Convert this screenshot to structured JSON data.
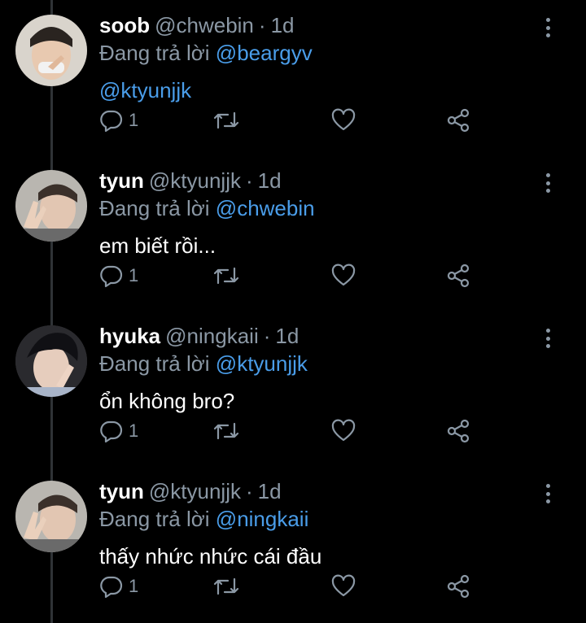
{
  "colors": {
    "background": "#000000",
    "muted": "#8b98a5",
    "mention": "#4a9de9",
    "text": "#ffffff"
  },
  "reply_prefix": "Đang trả lời",
  "tweets": [
    {
      "name": "soob",
      "handle": "@chwebin",
      "time": "1d",
      "replying_to": "@beargyv",
      "text": "",
      "text_mention": "@ktyunjjk",
      "reply_count": "1"
    },
    {
      "name": "tyun",
      "handle": "@ktyunjjk",
      "time": "1d",
      "replying_to": "@chwebin",
      "text": "em biết rồi...",
      "text_mention": "",
      "reply_count": "1"
    },
    {
      "name": "hyuka",
      "handle": "@ningkaii",
      "time": "1d",
      "replying_to": "@ktyunjjk",
      "text": "ổn không bro?",
      "text_mention": "",
      "reply_count": "1"
    },
    {
      "name": "tyun",
      "handle": "@ktyunjjk",
      "time": "1d",
      "replying_to": "@ningkaii",
      "text": "thấy nhức nhức cái đầu",
      "text_mention": "",
      "reply_count": "1"
    }
  ]
}
